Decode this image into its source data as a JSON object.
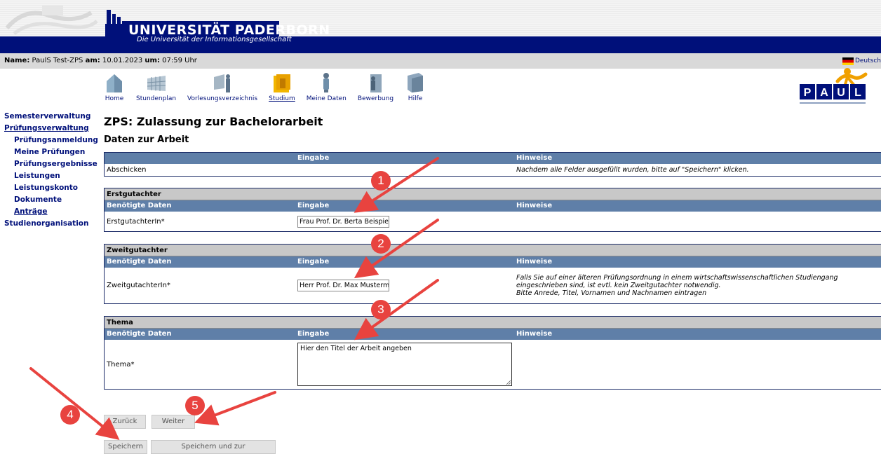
{
  "header": {
    "university_name": "UNIVERSITÄT PADERBORN",
    "university_subtitle": "Die Universität der Informationsgesellschaft"
  },
  "infobar": {
    "name_label": "Name:",
    "name_value": "PaulS Test-ZPS",
    "am_label": "am:",
    "date_value": "10.01.2023",
    "um_label": "um:",
    "time_value": "07:59 Uhr",
    "language": "Deutsch"
  },
  "nav": [
    {
      "label": "Home",
      "icon": "home-icon"
    },
    {
      "label": "Stundenplan",
      "icon": "calendar-icon"
    },
    {
      "label": "Vorlesungsverzeichnis",
      "icon": "lecture-icon"
    },
    {
      "label": "Studium",
      "icon": "folder-icon",
      "active": true
    },
    {
      "label": "Meine Daten",
      "icon": "person-icon"
    },
    {
      "label": "Bewerbung",
      "icon": "application-icon"
    },
    {
      "label": "Hilfe",
      "icon": "book-icon"
    }
  ],
  "sidebar": [
    {
      "label": "Semesterverwaltung",
      "level": 0
    },
    {
      "label": "Prüfungsverwaltung",
      "level": 0,
      "underline": true
    },
    {
      "label": "Prüfungsanmeldung",
      "level": 1
    },
    {
      "label": "Meine Prüfungen",
      "level": 1
    },
    {
      "label": "Prüfungsergebnisse",
      "level": 1
    },
    {
      "label": "Leistungen",
      "level": 1
    },
    {
      "label": "Leistungskonto",
      "level": 1
    },
    {
      "label": "Dokumente",
      "level": 1
    },
    {
      "label": "Anträge",
      "level": 1,
      "underline": true
    },
    {
      "label": "Studienorganisation",
      "level": 0
    }
  ],
  "main": {
    "title": "ZPS: Zulassung zur Bachelorarbeit",
    "section_title": "Daten zur Arbeit",
    "submit_table": {
      "headers": [
        "",
        "Eingabe",
        "Hinweise"
      ],
      "row_label": "Abschicken",
      "row_hint": "Nachdem alle Felder ausgefüllt wurden, bitte auf \"Speichern\" klicken."
    },
    "erstgutachter": {
      "title": "Erstgutachter",
      "headers": [
        "Benötigte Daten",
        "Eingabe",
        "Hinweise"
      ],
      "field_label": "ErstgutachterIn*",
      "value": "Frau Prof. Dr. Berta Beispiel"
    },
    "zweitgutachter": {
      "title": "Zweitgutachter",
      "headers": [
        "Benötigte Daten",
        "Eingabe",
        "Hinweise"
      ],
      "field_label": "ZweitgutachterIn*",
      "value": "Herr Prof. Dr. Max Mustermann",
      "hint_lines": [
        "Falls Sie auf einer älteren Prüfungsordnung in einem wirtschaftswissenschaftlichen Studiengang",
        "eingeschrieben sind, ist evtl. kein Zweitgutachter notwendig.",
        "Bitte Anrede, Titel, Vornamen und Nachnamen eintragen"
      ]
    },
    "thema": {
      "title": "Thema",
      "headers": [
        "Benötigte Daten",
        "Eingabe",
        "Hinweise"
      ],
      "field_label": "Thema*",
      "value": "Hier den Titel der Arbeit angeben"
    },
    "buttons": {
      "back": "Zurück",
      "next": "Weiter",
      "save": "Speichern",
      "save_overview": "Speichern und zur Antragsübersicht"
    }
  },
  "annotations": {
    "color": "#e8433f",
    "markers": [
      "1",
      "2",
      "3",
      "4",
      "5"
    ]
  }
}
